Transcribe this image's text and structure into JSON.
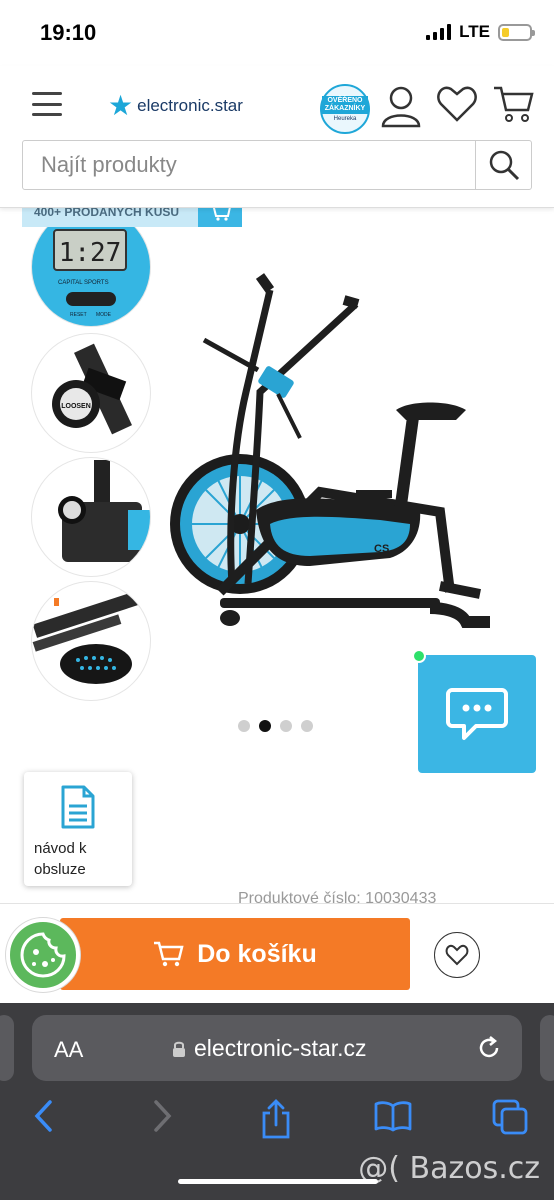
{
  "status_bar": {
    "time": "19:10",
    "network": "LTE",
    "battery_level": 0.25
  },
  "header": {
    "menu_icon": "hamburger-menu-icon",
    "logo_text": "electronic.star",
    "badge_line1": "OVĚŘENO ZÁKAZNÍKY",
    "badge_line2": "Heureka",
    "icons": [
      "user-icon",
      "heart-icon",
      "cart-icon"
    ]
  },
  "search": {
    "placeholder": "Najít produkty"
  },
  "sold_strip": {
    "text": "400+ PRODANÝCH KUSŮ"
  },
  "gallery": {
    "thumbnail_count": 4,
    "active_index": 1,
    "dot_count": 4,
    "console_display": "1:27",
    "console_brand": "CAPITAL SPORTS",
    "console_buttons": [
      "RESET",
      "MODE"
    ],
    "knob_label": "LOOSEN",
    "bike_model": "CS"
  },
  "chat": {
    "icon": "chat-bubble-icon",
    "online_color": "#2ee06a"
  },
  "manual": {
    "label_line1": "návod k",
    "label_line2": "obsluze"
  },
  "product_number": "Produktové číslo: 10030433",
  "buy": {
    "add_to_cart": "Do košíku",
    "accent_color": "#f47a26"
  },
  "safari": {
    "text_size": "AA",
    "url": "electronic-star.cz"
  },
  "watermark": "@( Bazos.cz",
  "colors": {
    "brand_blue": "#1da7d8",
    "chat_blue": "#3bb6e4",
    "cookie_green": "#5cb85c"
  }
}
